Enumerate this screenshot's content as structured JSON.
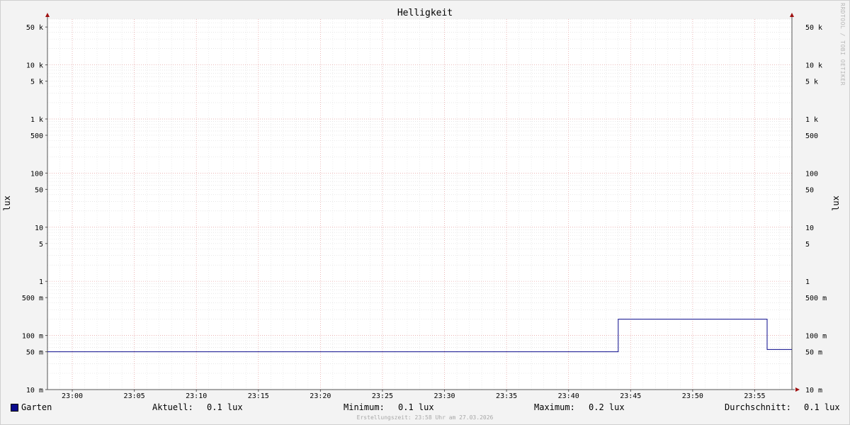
{
  "chart_data": {
    "type": "line",
    "title": "Helligkeit",
    "ylabel": "lux",
    "yscale": "log",
    "ylim": [
      0.01,
      70000
    ],
    "xlim": [
      "22:58",
      "23:58"
    ],
    "y_ticks": [
      {
        "v": 50000,
        "label": "50 k"
      },
      {
        "v": 10000,
        "label": "10 k"
      },
      {
        "v": 5000,
        "label": "5 k"
      },
      {
        "v": 1000,
        "label": "1 k"
      },
      {
        "v": 500,
        "label": "500"
      },
      {
        "v": 100,
        "label": "100"
      },
      {
        "v": 50,
        "label": "50"
      },
      {
        "v": 10,
        "label": "10"
      },
      {
        "v": 5,
        "label": "5"
      },
      {
        "v": 1,
        "label": "1"
      },
      {
        "v": 0.5,
        "label": "500 m"
      },
      {
        "v": 0.1,
        "label": "100 m"
      },
      {
        "v": 0.05,
        "label": "50 m"
      },
      {
        "v": 0.01,
        "label": "10 m"
      }
    ],
    "x_ticks": [
      "23:00",
      "23:05",
      "23:10",
      "23:15",
      "23:20",
      "23:25",
      "23:30",
      "23:35",
      "23:40",
      "23:45",
      "23:50",
      "23:55"
    ],
    "series": [
      {
        "name": "Garten",
        "color": "#0a0a8c",
        "points": [
          [
            "22:58",
            0.05
          ],
          [
            "23:44",
            0.05
          ],
          [
            "23:44",
            0.2
          ],
          [
            "23:56",
            0.2
          ],
          [
            "23:56",
            0.055
          ],
          [
            "23:58",
            0.055
          ]
        ]
      }
    ],
    "grid": true,
    "legend_position": "bottom-left"
  },
  "legend": {
    "series_name": "Garten",
    "series_color": "#0a0a8c",
    "current_label": "Aktuell:",
    "current_value": "0.1 lux",
    "min_label": "Minimum:",
    "min_value": "0.1 lux",
    "max_label": "Maximum:",
    "max_value": "0.2 lux",
    "avg_label": "Durchschnitt:",
    "avg_value": "0.1 lux"
  },
  "watermark": "RRDTOOL / TOBI OETIKER",
  "footer": "Erstellungszeit: 23:58 Uhr am 27.03.2026"
}
